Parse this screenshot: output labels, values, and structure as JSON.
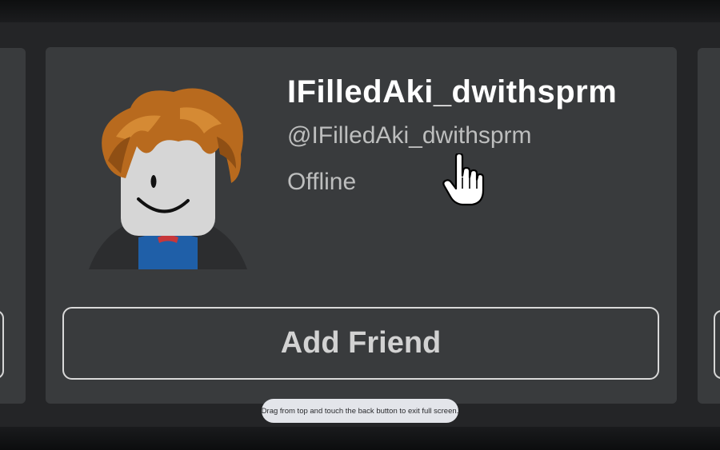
{
  "profile": {
    "display_name": "IFilledAki_dwithsprm",
    "username": "@IFilledAki_dwithsprm",
    "status": "Offline"
  },
  "actions": {
    "add_friend_label": "Add Friend"
  },
  "toast": {
    "message": "Drag from top and touch the back button to exit full screen."
  },
  "icons": {
    "avatar": "avatar-image",
    "cursor": "hand-pointer-icon"
  },
  "colors": {
    "card_background": "#393b3d",
    "band_background": "#242527",
    "display_name": "#ffffff",
    "secondary_text": "#bdbebe",
    "button_border": "#d9d9d9",
    "toast_background": "#e3e5ea"
  }
}
